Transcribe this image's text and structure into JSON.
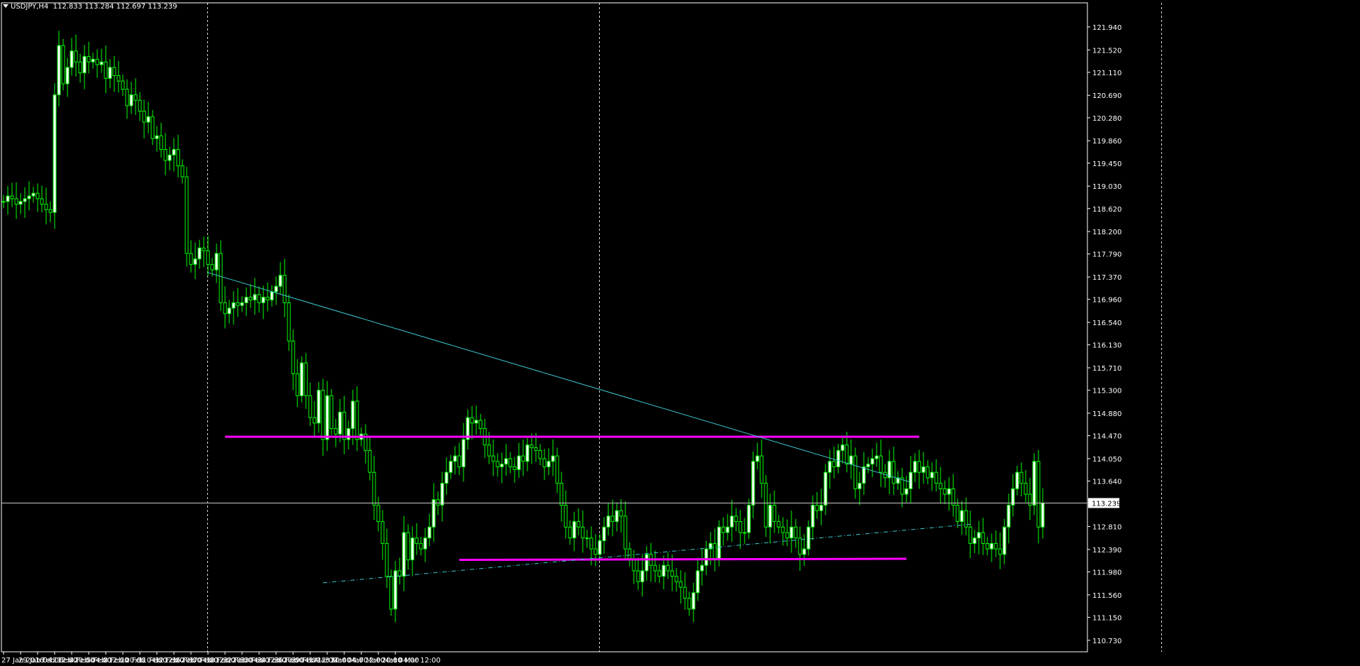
{
  "header": {
    "symbol": "USDJPY,H4",
    "ohlc": "112.833 113.284 112.697 113.239"
  },
  "colors": {
    "background": "#000000",
    "candle": "#00ff00",
    "bull_body": "#ffffff",
    "bear_body": "#000000",
    "grid": "#ffffff",
    "resistance": "#ff00ff",
    "trendline": "#3cc8d0",
    "price_line": "#c8c8c8",
    "axis": "#ffffff"
  },
  "chart_data": {
    "type": "candlestick",
    "title": "USDJPY,H4",
    "ylim": [
      110.52,
      122.38
    ],
    "y_ticks": [
      "121.940",
      "121.520",
      "121.110",
      "120.690",
      "120.280",
      "119.860",
      "119.450",
      "119.030",
      "118.620",
      "118.200",
      "117.790",
      "117.370",
      "116.960",
      "116.540",
      "116.130",
      "115.710",
      "115.300",
      "114.880",
      "114.470",
      "114.050",
      "113.640",
      "112.810",
      "112.390",
      "111.980",
      "111.560",
      "111.150",
      "110.730"
    ],
    "current_price": "113.239",
    "x_ticks": [
      "27 Jan 2016",
      "29 Jan 04:00",
      "1 Feb 12:00",
      "2 Feb 20:00",
      "4 Feb 04:00",
      "5 Feb 12:00",
      "8 Feb 20:00",
      "10 Feb 04:00",
      "11 Feb 12:00",
      "12 Feb 20:00",
      "16 Feb 04:00",
      "17 Feb 12:00",
      "18 Feb 20:00",
      "22 Feb 04:00",
      "23 Feb 12:00",
      "24 Feb 20:00",
      "26 Feb 04:00",
      "29 Feb 12:00",
      "1 Mar 20:00",
      "3 Mar 04:00",
      "4 Mar 12:00",
      "7 Mar 20:00",
      "9 Mar 04:00",
      "10 Mar 12:00"
    ],
    "vertical_grid_bars": [
      12,
      35,
      68,
      101,
      134,
      167,
      200,
      233
    ],
    "bars_per_label": 4,
    "close": [
      118.75,
      118.85,
      118.8,
      118.7,
      118.75,
      118.8,
      118.85,
      118.9,
      118.8,
      118.7,
      118.6,
      118.55,
      120.7,
      121.6,
      120.9,
      121.2,
      121.5,
      121.3,
      121.1,
      121.4,
      121.3,
      121.35,
      121.25,
      121.3,
      121.0,
      121.2,
      121.05,
      120.95,
      120.8,
      120.5,
      120.7,
      120.6,
      120.4,
      120.2,
      120.3,
      119.9,
      119.95,
      119.7,
      119.5,
      119.6,
      119.7,
      119.4,
      119.2,
      117.8,
      117.6,
      117.7,
      117.9,
      117.85,
      117.6,
      117.5,
      117.8,
      116.9,
      116.7,
      116.8,
      116.9,
      116.85,
      116.9,
      117.0,
      116.95,
      117.05,
      116.9,
      117.0,
      116.95,
      117.1,
      117.2,
      117.4,
      116.9,
      116.2,
      115.6,
      115.2,
      115.8,
      115.2,
      114.8,
      114.7,
      115.3,
      114.4,
      115.2,
      114.6,
      114.5,
      114.9,
      114.4,
      114.6,
      115.1,
      114.4,
      114.5,
      114.2,
      113.8,
      113.2,
      112.9,
      112.5,
      111.9,
      111.3,
      112.0,
      111.9,
      112.7,
      112.2,
      112.6,
      112.5,
      112.4,
      112.6,
      112.8,
      113.3,
      113.2,
      113.6,
      113.8,
      114.0,
      114.1,
      113.9,
      114.4,
      114.8,
      114.7,
      114.75,
      114.6,
      114.3,
      114.1,
      114.0,
      113.9,
      113.95,
      114.05,
      113.9,
      113.85,
      114.1,
      114.0,
      114.3,
      114.25,
      114.2,
      114.05,
      113.9,
      114.0,
      114.1,
      113.6,
      113.2,
      112.8,
      112.6,
      112.9,
      112.8,
      112.6,
      112.6,
      112.4,
      112.3,
      112.55,
      112.8,
      113.0,
      112.9,
      113.1,
      113.0,
      112.4,
      112.2,
      112.0,
      111.8,
      112.0,
      112.3,
      112.1,
      112.0,
      111.9,
      112.1,
      112.0,
      111.9,
      111.8,
      111.7,
      111.5,
      111.3,
      111.6,
      112.0,
      112.1,
      112.4,
      112.5,
      112.2,
      112.8,
      112.7,
      112.8,
      113.0,
      112.9,
      112.7,
      112.7,
      113.2,
      114.0,
      114.1,
      113.6,
      112.8,
      113.2,
      112.9,
      112.8,
      112.7,
      112.6,
      112.8,
      112.6,
      112.3,
      112.4,
      112.8,
      113.2,
      113.1,
      113.2,
      113.8,
      114.0,
      113.9,
      114.2,
      114.3,
      113.95,
      114.1,
      113.5,
      113.6,
      113.9,
      113.95,
      114.05,
      114.1,
      113.8,
      113.7,
      114.0,
      113.6,
      113.7,
      113.4,
      113.5,
      113.8,
      114.0,
      113.8,
      113.9,
      113.7,
      113.8,
      113.6,
      113.5,
      113.4,
      113.5,
      113.2,
      112.9,
      113.1,
      112.8,
      112.5,
      112.6,
      112.7,
      112.5,
      112.4,
      112.5,
      112.4,
      112.3,
      112.8,
      113.2,
      113.5,
      113.8,
      113.6,
      113.4,
      113.2,
      114.0,
      112.8,
      113.24
    ],
    "resistance": [
      114.45,
      114.45
    ],
    "support": [
      112.2,
      112.22
    ]
  }
}
